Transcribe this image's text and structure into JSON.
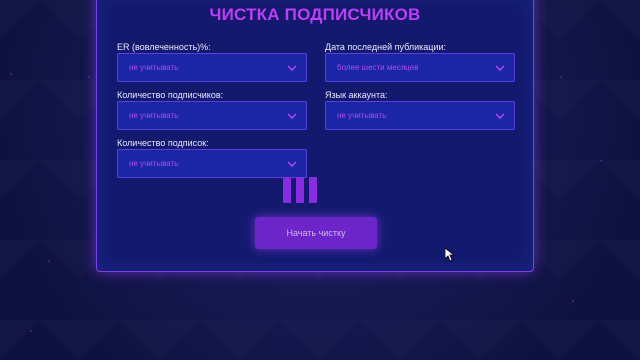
{
  "title": "ЧИСТКА ПОДПИСЧИКОВ",
  "fields": [
    {
      "label": "ER (вовлеченность)%:",
      "value": "не учитывать"
    },
    {
      "label": "Дата последней публикации:",
      "value": "более шести месяцев"
    },
    {
      "label": "Количество подписчиков:",
      "value": "не учитывать"
    },
    {
      "label": "Язык аккаунта:",
      "value": "не учитывать"
    },
    {
      "label": "Количество подписок:",
      "value": "не учитывать"
    }
  ],
  "loader_icon": "loading-bars-icon",
  "start_button_label": "Начать чистку",
  "colors": {
    "background": "#0f1240",
    "panel": "#131a6e",
    "accent": "#c13cf5",
    "select_bg": "#1b25a6",
    "button": "#6b25c8"
  }
}
